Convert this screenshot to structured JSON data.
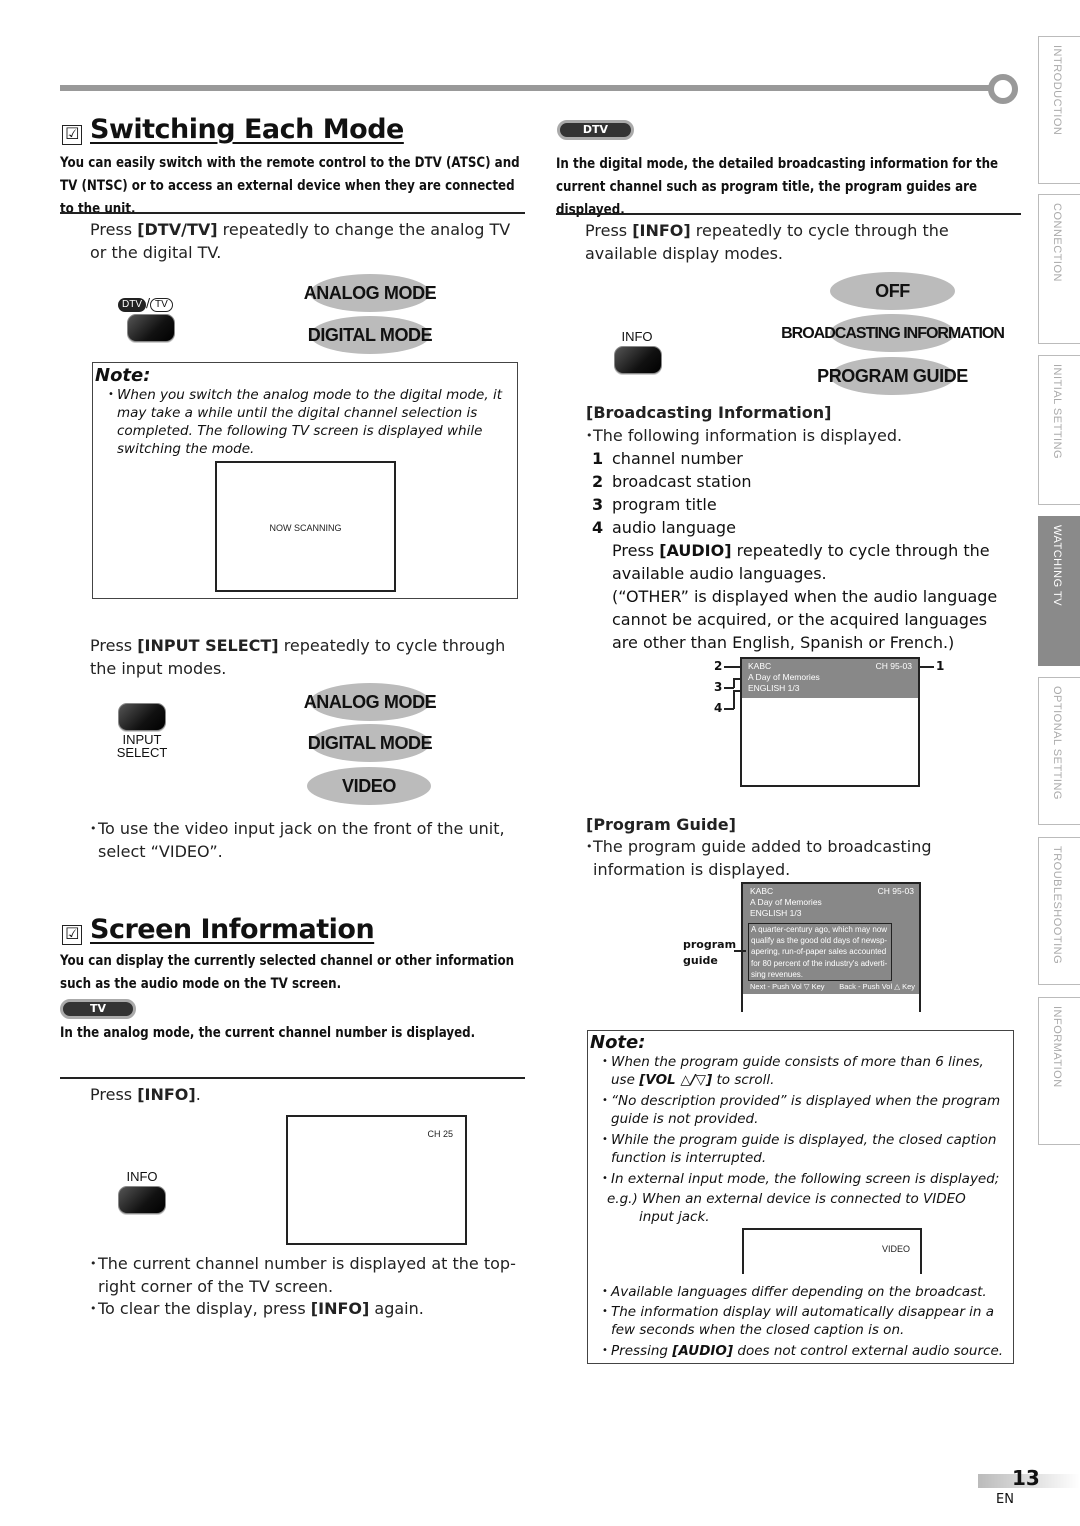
{
  "switching": {
    "title": "Switching Each Mode",
    "checkbox_glyph": "☑",
    "lead": "You can easily switch with the remote control to the DTV (ATSC) and TV (NTSC) or to access an external device when they are connected to the unit.",
    "step1_pre": "Press ",
    "step1_key": "[DTV/TV]",
    "step1_post": " repeatedly to change the analog TV or the digital TV.",
    "dtv_tv_label_dtv": "DTV",
    "dtv_tv_label_tv": "TV",
    "modes1": [
      "ANALOG MODE",
      "DIGITAL MODE"
    ],
    "note": {
      "heading": "Note:",
      "item": "When you switch the analog mode to the digital mode, it may take a while until the digital channel selection is completed. The following TV screen is displayed while switching the mode.",
      "screen_text": "NOW SCANNING"
    },
    "step2_pre": "Press ",
    "step2_key": "[INPUT SELECT]",
    "step2_post": " repeatedly to cycle through the input modes.",
    "input_select_label_1": "INPUT",
    "input_select_label_2": "SELECT",
    "modes2": [
      "ANALOG MODE",
      "DIGITAL MODE",
      "VIDEO"
    ],
    "bullet": "To use the video input jack on the front of the unit, select “VIDEO”."
  },
  "screen_info": {
    "title": "Screen Information",
    "checkbox_glyph": "☑",
    "lead": "You can display the currently selected channel or other information such as the audio mode on the TV screen.",
    "tv_badge": "TV",
    "analog_desc": "In the analog mode, the current channel number is displayed.",
    "step_pre": "Press ",
    "step_key": "[INFO]",
    "step_post": ".",
    "info_button_label": "INFO",
    "screen_channel": "CH 25",
    "bullet1": "The current channel number is displayed at the top-right corner of the TV screen.",
    "bullet2_pre": "To clear the display, press ",
    "bullet2_key": "[INFO]",
    "bullet2_post": " again."
  },
  "dtv": {
    "badge": "DTV",
    "lead": "In the digital mode, the detailed broadcasting information for the current channel such as program title, the program guides are displayed.",
    "step_pre": "Press ",
    "step_key": "[INFO]",
    "step_post": " repeatedly to cycle through the available display modes.",
    "info_button_label": "INFO",
    "modes": [
      "OFF",
      "BROADCASTING INFORMATION",
      "PROGRAM GUIDE"
    ],
    "broadcast_heading": "[Broadcasting Information]",
    "broadcast_bullet": "The following information is displayed.",
    "items": [
      {
        "n": "1",
        "label": "channel number"
      },
      {
        "n": "2",
        "label": "broadcast station"
      },
      {
        "n": "3",
        "label": "program title"
      },
      {
        "n": "4",
        "label": "audio language"
      }
    ],
    "audio_pre": "Press ",
    "audio_key": "[AUDIO]",
    "audio_post": " repeatedly to cycle through the available audio languages.",
    "other_note": "(“OTHER” is displayed when the audio language cannot be acquired, or the acquired languages are other than English, Spanish or French.)",
    "screen": {
      "station": "KABC",
      "channel": "CH 95-03",
      "program_title": "A Day of Memories",
      "audio": "ENGLISH  1/3",
      "callouts": [
        "1",
        "2",
        "3",
        "4"
      ]
    },
    "guide_heading": "[Program Guide]",
    "guide_bullet": "The program guide added to broadcasting information is displayed.",
    "guide_screen": {
      "station": "KABC",
      "channel": "CH 95-03",
      "program_title": "A Day of Memories",
      "audio": "ENGLISH  1/3",
      "guide_lines": [
        "A quarter-century ago, which may now",
        "qualify as the good old days of newsp-",
        "apering, run-of-paper sales accounted",
        "for 80 percent of the industry's adverti-",
        "sing revenues."
      ],
      "footer_next": "Next - Push Vol ▽ Key",
      "footer_back": "Back - Push Vol △ Key",
      "label_1": "program",
      "label_2": "guide"
    },
    "note": {
      "heading": "Note:",
      "item1_pre": "When the program guide consists of more than 6 lines, use ",
      "item1_key": "[VOL △/▽]",
      "item1_post": " to scroll.",
      "item2": "“No description provided” is displayed when the program guide is not provided.",
      "item3": "While the program guide is displayed, the closed caption function is interrupted.",
      "item4": "In external input mode, the following screen is displayed;",
      "item4_eg": "e.g.) When an external device is connected to VIDEO input jack.",
      "video_screen_text": "VIDEO",
      "item5": "Available languages differ depending on the broadcast.",
      "item6": "The information display will automatically disappear in a few seconds when the closed caption is on.",
      "item7_pre": "Pressing ",
      "item7_key": "[AUDIO]",
      "item7_post": " does not control external audio source."
    }
  },
  "side_tabs": [
    {
      "label": "INTRODUCTION",
      "active": false
    },
    {
      "label": "CONNECTION",
      "active": false
    },
    {
      "label": "INITIAL  SETTING",
      "active": false
    },
    {
      "label": "WATCHING  TV",
      "active": true
    },
    {
      "label": "OPTIONAL  SETTING",
      "active": false
    },
    {
      "label": "TROUBLESHOOTING",
      "active": false
    },
    {
      "label": "INFORMATION",
      "active": false
    }
  ],
  "footer": {
    "page_number": "13",
    "language": "EN"
  }
}
